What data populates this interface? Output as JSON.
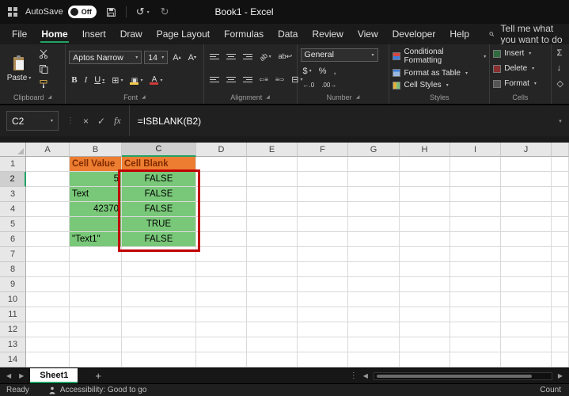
{
  "colors": {
    "accent": "#21A366",
    "header_fill": "#ED7D31",
    "header_text": "#7F2B00",
    "cell_fill": "#79C879",
    "annotation": "#C00000"
  },
  "titlebar": {
    "autosave_label": "AutoSave",
    "autosave_state": "Off",
    "title": "Book1 - Excel"
  },
  "menu": {
    "tabs": [
      {
        "label": "File",
        "active": false
      },
      {
        "label": "Home",
        "active": true
      },
      {
        "label": "Insert",
        "active": false
      },
      {
        "label": "Draw",
        "active": false
      },
      {
        "label": "Page Layout",
        "active": false
      },
      {
        "label": "Formulas",
        "active": false
      },
      {
        "label": "Data",
        "active": false
      },
      {
        "label": "Review",
        "active": false
      },
      {
        "label": "View",
        "active": false
      },
      {
        "label": "Developer",
        "active": false
      },
      {
        "label": "Help",
        "active": false
      }
    ],
    "search_text": "Tell me what you want to do"
  },
  "ribbon": {
    "clipboard": {
      "label": "Clipboard",
      "paste_label": "Paste"
    },
    "font": {
      "label": "Font",
      "font_name": "Aptos Narrow",
      "font_size": "14"
    },
    "alignment": {
      "label": "Alignment"
    },
    "number": {
      "label": "Number",
      "format": "General"
    },
    "styles": {
      "label": "Styles",
      "items": [
        "Conditional Formatting",
        "Format as Table",
        "Cell Styles"
      ]
    },
    "cells": {
      "label": "Cells",
      "items": [
        "Insert",
        "Delete",
        "Format"
      ]
    }
  },
  "formula_bar": {
    "name_box": "C2",
    "formula": "=ISBLANK(B2)"
  },
  "grid": {
    "columns": [
      "A",
      "B",
      "C",
      "D",
      "E",
      "F",
      "G",
      "H",
      "I",
      "J",
      ""
    ],
    "row_count": 14,
    "selected_cell": "C2",
    "selected_column": "C",
    "selected_row": "2",
    "cells": [
      {
        "ref": "B1",
        "text": "Cell Value",
        "kind": "header",
        "align": "left"
      },
      {
        "ref": "C1",
        "text": "Cell Blank",
        "kind": "header",
        "align": "left"
      },
      {
        "ref": "B2",
        "text": "5",
        "kind": "value",
        "align": "right"
      },
      {
        "ref": "C2",
        "text": "FALSE",
        "kind": "value",
        "align": "center"
      },
      {
        "ref": "B3",
        "text": "Text",
        "kind": "value",
        "align": "left"
      },
      {
        "ref": "C3",
        "text": "FALSE",
        "kind": "value",
        "align": "center"
      },
      {
        "ref": "B4",
        "text": "42370",
        "kind": "value",
        "align": "right"
      },
      {
        "ref": "C4",
        "text": "FALSE",
        "kind": "value",
        "align": "center"
      },
      {
        "ref": "B5",
        "text": "",
        "kind": "value",
        "align": "left"
      },
      {
        "ref": "C5",
        "text": "TRUE",
        "kind": "value",
        "align": "center"
      },
      {
        "ref": "B6",
        "text": "\"Text1\"",
        "kind": "value",
        "align": "left"
      },
      {
        "ref": "C6",
        "text": "FALSE",
        "kind": "value",
        "align": "center"
      }
    ],
    "annotation_range": "C2:C6"
  },
  "sheet_bar": {
    "tabs": [
      {
        "label": "Sheet1",
        "active": true
      }
    ]
  },
  "status_bar": {
    "ready": "Ready",
    "accessibility": "Accessibility: Good to go",
    "right": "Count"
  }
}
